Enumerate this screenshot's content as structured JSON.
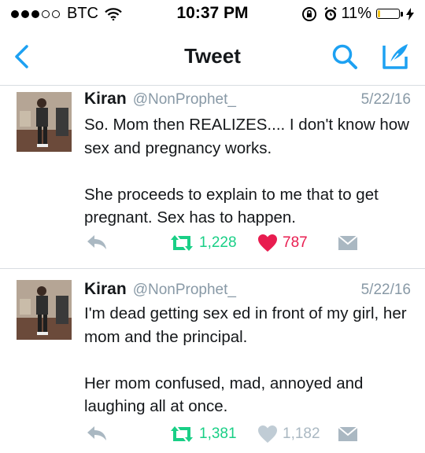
{
  "status_bar": {
    "carrier": "BTC",
    "time": "10:37 PM",
    "battery_pct": "11%",
    "battery_level": 0.11,
    "signal_dots_filled": 3,
    "signal_dots_total": 5
  },
  "nav": {
    "title": "Tweet",
    "accent_color": "#1da1f2"
  },
  "tweets": [
    {
      "name": "Kiran",
      "handle": "@NonProphet_",
      "date": "5/22/16",
      "text": "So. Mom then REALIZES.... I don't know how sex and pregnancy works.\n\nShe proceeds to explain to me that to get pregnant. Sex has to happen.",
      "retweets": "1,228",
      "likes": "787",
      "liked": true
    },
    {
      "name": "Kiran",
      "handle": "@NonProphet_",
      "date": "5/22/16",
      "text": "I'm dead getting sex ed in front of my girl, her mom and the principal.\n\nHer mom confused, mad, annoyed and laughing all at once.",
      "retweets": "1,381",
      "likes": "1,182",
      "liked": false
    }
  ],
  "icons": {
    "back": "chevron-left-icon",
    "search": "search-icon",
    "compose": "compose-icon",
    "reply": "reply-icon",
    "retweet": "retweet-icon",
    "like": "heart-icon",
    "dm": "envelope-icon"
  },
  "colors": {
    "retweet_green": "#19cf86",
    "like_red": "#e81c4f",
    "meta_gray": "#8899a6",
    "icon_gray": "#aab8c2"
  }
}
